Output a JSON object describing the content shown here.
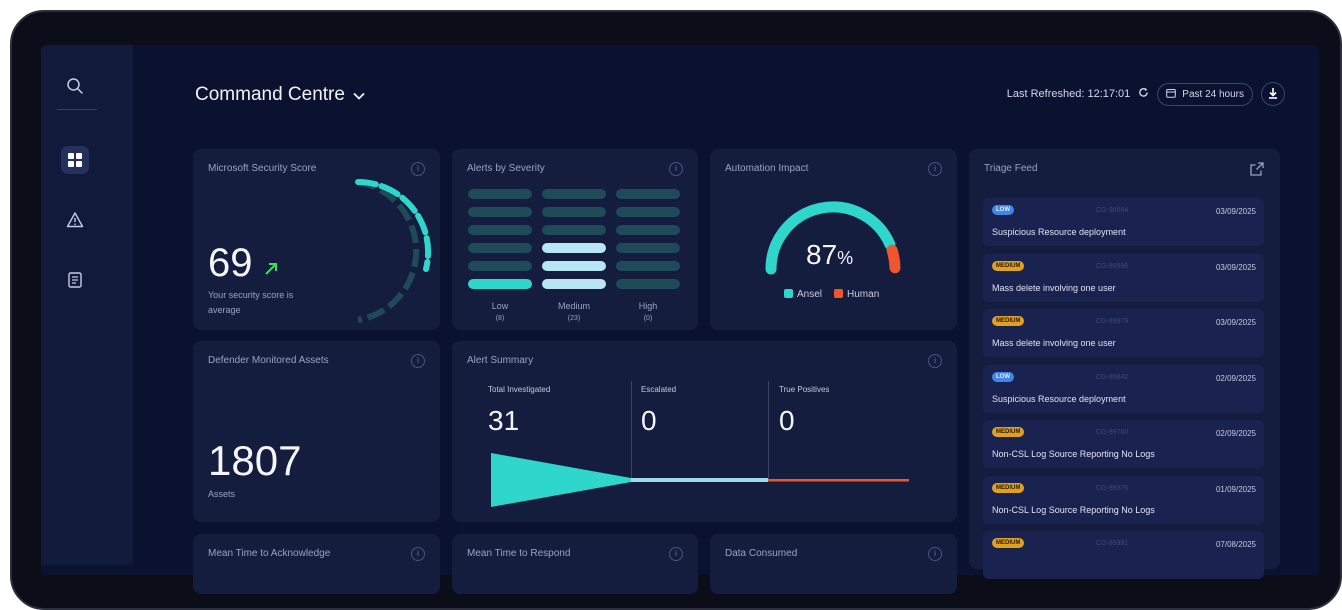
{
  "header": {
    "title": "Command Centre",
    "last_refreshed": "Last Refreshed: 12:17:01",
    "time_range": "Past 24 hours"
  },
  "sidebar": {
    "items": [
      {
        "icon": "search-icon"
      },
      {
        "icon": "dashboard-icon",
        "active": true
      },
      {
        "icon": "warning-icon"
      },
      {
        "icon": "report-icon"
      }
    ]
  },
  "security_score": {
    "title": "Microsoft Security Score",
    "value": "69",
    "caption_line1": "Your security score is",
    "caption_line2": "average",
    "trend_color": "#3ddc5c"
  },
  "alerts_by_severity": {
    "title": "Alerts by Severity",
    "columns": [
      {
        "label": "Low",
        "count": "(8)",
        "filled": 1
      },
      {
        "label": "Medium",
        "count": "(23)",
        "filled": 3
      },
      {
        "label": "High",
        "count": "(0)",
        "filled": 0
      }
    ]
  },
  "automation_impact": {
    "title": "Automation Impact",
    "value": "87",
    "unit": "%",
    "fraction": 0.87,
    "legend": [
      {
        "label": "Ansel",
        "color": "#2fd6cc"
      },
      {
        "label": "Human",
        "color": "#f0562e"
      }
    ]
  },
  "triage_feed": {
    "title": "Triage Feed",
    "items": [
      {
        "severity": "LOW",
        "id": "CG-90064",
        "date": "03/09/2025",
        "title": "Suspicious Resource deployment"
      },
      {
        "severity": "MEDIUM",
        "id": "CG-89996",
        "date": "03/09/2025",
        "title": "Mass delete involving one user"
      },
      {
        "severity": "MEDIUM",
        "id": "CG-89979",
        "date": "03/09/2025",
        "title": "Mass delete involving one user"
      },
      {
        "severity": "LOW",
        "id": "CG-89842",
        "date": "02/09/2025",
        "title": "Suspicious Resource deployment"
      },
      {
        "severity": "MEDIUM",
        "id": "CG-89760",
        "date": "02/09/2025",
        "title": "Non-CSL Log Source Reporting No Logs"
      },
      {
        "severity": "MEDIUM",
        "id": "CG-89375",
        "date": "01/09/2025",
        "title": "Non-CSL Log Source Reporting No Logs"
      },
      {
        "severity": "MEDIUM",
        "id": "CG-89391",
        "date": "07/08/2025",
        "title": ""
      }
    ]
  },
  "defender_assets": {
    "title": "Defender Monitored Assets",
    "value": "1807",
    "caption": "Assets"
  },
  "alert_summary": {
    "title": "Alert Summary",
    "stats": [
      {
        "label": "Total Investigated",
        "value": "31"
      },
      {
        "label": "Escalated",
        "value": "0"
      },
      {
        "label": "True Positives",
        "value": "0"
      }
    ]
  },
  "bottom_cards": [
    {
      "title": "Mean Time to Acknowledge"
    },
    {
      "title": "Mean Time to Respond"
    },
    {
      "title": "Data Consumed"
    }
  ],
  "colors": {
    "accent_teal": "#2fd6cc",
    "accent_orange": "#f0562e",
    "card_bg": "#151d3f"
  }
}
